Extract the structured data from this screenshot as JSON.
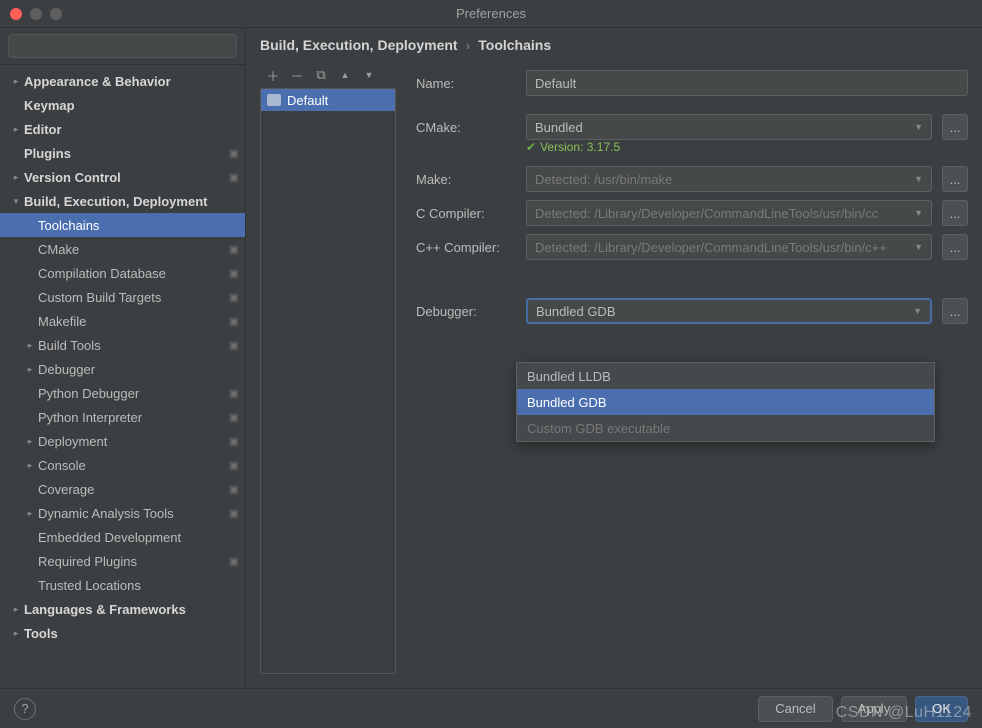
{
  "window": {
    "title": "Preferences"
  },
  "search": {
    "placeholder": ""
  },
  "sidebar": {
    "items": [
      {
        "label": "Appearance & Behavior",
        "arrow": ">",
        "indent": 0,
        "bold": true
      },
      {
        "label": "Keymap",
        "arrow": "",
        "indent": 0,
        "bold": true
      },
      {
        "label": "Editor",
        "arrow": ">",
        "indent": 0,
        "bold": true
      },
      {
        "label": "Plugins",
        "arrow": "",
        "indent": 0,
        "bold": true,
        "lock": true
      },
      {
        "label": "Version Control",
        "arrow": ">",
        "indent": 0,
        "bold": true,
        "lock": true
      },
      {
        "label": "Build, Execution, Deployment",
        "arrow": "v",
        "indent": 0,
        "bold": true
      },
      {
        "label": "Toolchains",
        "arrow": "",
        "indent": 1,
        "selected": true
      },
      {
        "label": "CMake",
        "arrow": "",
        "indent": 1,
        "lock": true
      },
      {
        "label": "Compilation Database",
        "arrow": "",
        "indent": 1,
        "lock": true
      },
      {
        "label": "Custom Build Targets",
        "arrow": "",
        "indent": 1,
        "lock": true
      },
      {
        "label": "Makefile",
        "arrow": "",
        "indent": 1,
        "lock": true
      },
      {
        "label": "Build Tools",
        "arrow": ">",
        "indent": 1,
        "lock": true
      },
      {
        "label": "Debugger",
        "arrow": ">",
        "indent": 1
      },
      {
        "label": "Python Debugger",
        "arrow": "",
        "indent": 1,
        "lock": true
      },
      {
        "label": "Python Interpreter",
        "arrow": "",
        "indent": 1,
        "lock": true
      },
      {
        "label": "Deployment",
        "arrow": ">",
        "indent": 1,
        "lock": true
      },
      {
        "label": "Console",
        "arrow": ">",
        "indent": 1,
        "lock": true
      },
      {
        "label": "Coverage",
        "arrow": "",
        "indent": 1,
        "lock": true
      },
      {
        "label": "Dynamic Analysis Tools",
        "arrow": ">",
        "indent": 1,
        "lock": true
      },
      {
        "label": "Embedded Development",
        "arrow": "",
        "indent": 1
      },
      {
        "label": "Required Plugins",
        "arrow": "",
        "indent": 1,
        "lock": true
      },
      {
        "label": "Trusted Locations",
        "arrow": "",
        "indent": 1
      },
      {
        "label": "Languages & Frameworks",
        "arrow": ">",
        "indent": 0,
        "bold": true
      },
      {
        "label": "Tools",
        "arrow": ">",
        "indent": 0,
        "bold": true
      }
    ]
  },
  "breadcrumb": {
    "part1": "Build, Execution, Deployment",
    "sep": "›",
    "part2": "Toolchains"
  },
  "toolchain_list": {
    "items": [
      {
        "label": "Default"
      }
    ]
  },
  "form": {
    "name_label": "Name:",
    "name_value": "Default",
    "cmake_label": "CMake:",
    "cmake_value": "Bundled",
    "cmake_version": "Version: 3.17.5",
    "make_label": "Make:",
    "make_value": "Detected: /usr/bin/make",
    "ccompiler_label": "C Compiler:",
    "ccompiler_value": "Detected: /Library/Developer/CommandLineTools/usr/bin/cc",
    "cppcompiler_label": "C++ Compiler:",
    "cppcompiler_value": "Detected: /Library/Developer/CommandLineTools/usr/bin/c++",
    "debugger_label": "Debugger:",
    "debugger_value": "Bundled GDB",
    "debugger_options": [
      {
        "label": "Bundled LLDB"
      },
      {
        "label": "Bundled GDB",
        "selected": true
      },
      {
        "label": "Custom GDB executable",
        "disabled": true
      }
    ],
    "ellipsis": "..."
  },
  "footer": {
    "help": "?",
    "cancel": "Cancel",
    "apply": "Apply",
    "ok": "OK"
  },
  "watermark": "CSDN @LuH1124"
}
